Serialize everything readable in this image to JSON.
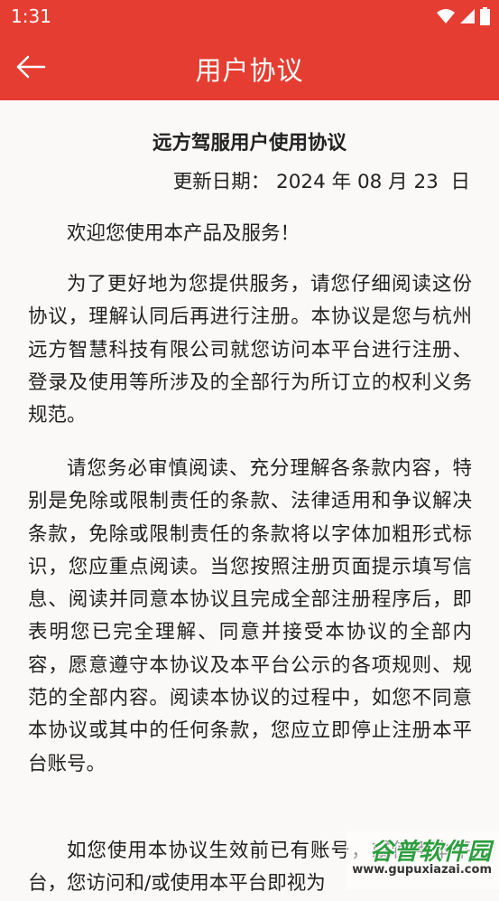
{
  "status_bar": {
    "time": "1:31",
    "icons": [
      "wifi-icon",
      "signal-icon",
      "battery-icon"
    ]
  },
  "header": {
    "title": "用户协议",
    "back_icon": "arrow-left-icon",
    "color": "#e53d31"
  },
  "document": {
    "title": "远方驾服用户使用协议",
    "update_date": "更新日期： 2024 年 08 月 23  日",
    "welcome": "欢迎您使用本产品及服务！",
    "paragraphs": [
      "为了更好地为您提供服务，请您仔细阅读这份协议，理解认同后再进行注册。本协议是您与杭州远方智慧科技有限公司就您访问本平台进行注册、登录及使用等所涉及的全部行为所订立的权利义务规范。",
      "请您务必审慎阅读、充分理解各条款内容，特别是免除或限制责任的条款、法律适用和争议解决条款，免除或限制责任的条款将以字体加粗形式标识，您应重点阅读。当您按照注册页面提示填写信息、阅读并同意本协议且完成全部注册程序后，即表明您已完全理解、同意并接受本协议的全部内容，愿意遵守本协议及本平台公示的各项规则、规范的全部内容。阅读本协议的过程中，如您不同意本协议或其中的任何条款，您应立即停止注册本平台账号。",
      "如您使用本协议生效前已有账号，或使用本平台，您访问和/或使用本平台即视为"
    ]
  },
  "watermark": {
    "title": "谷普软件园",
    "url": "www.gupuxiazai.com"
  }
}
